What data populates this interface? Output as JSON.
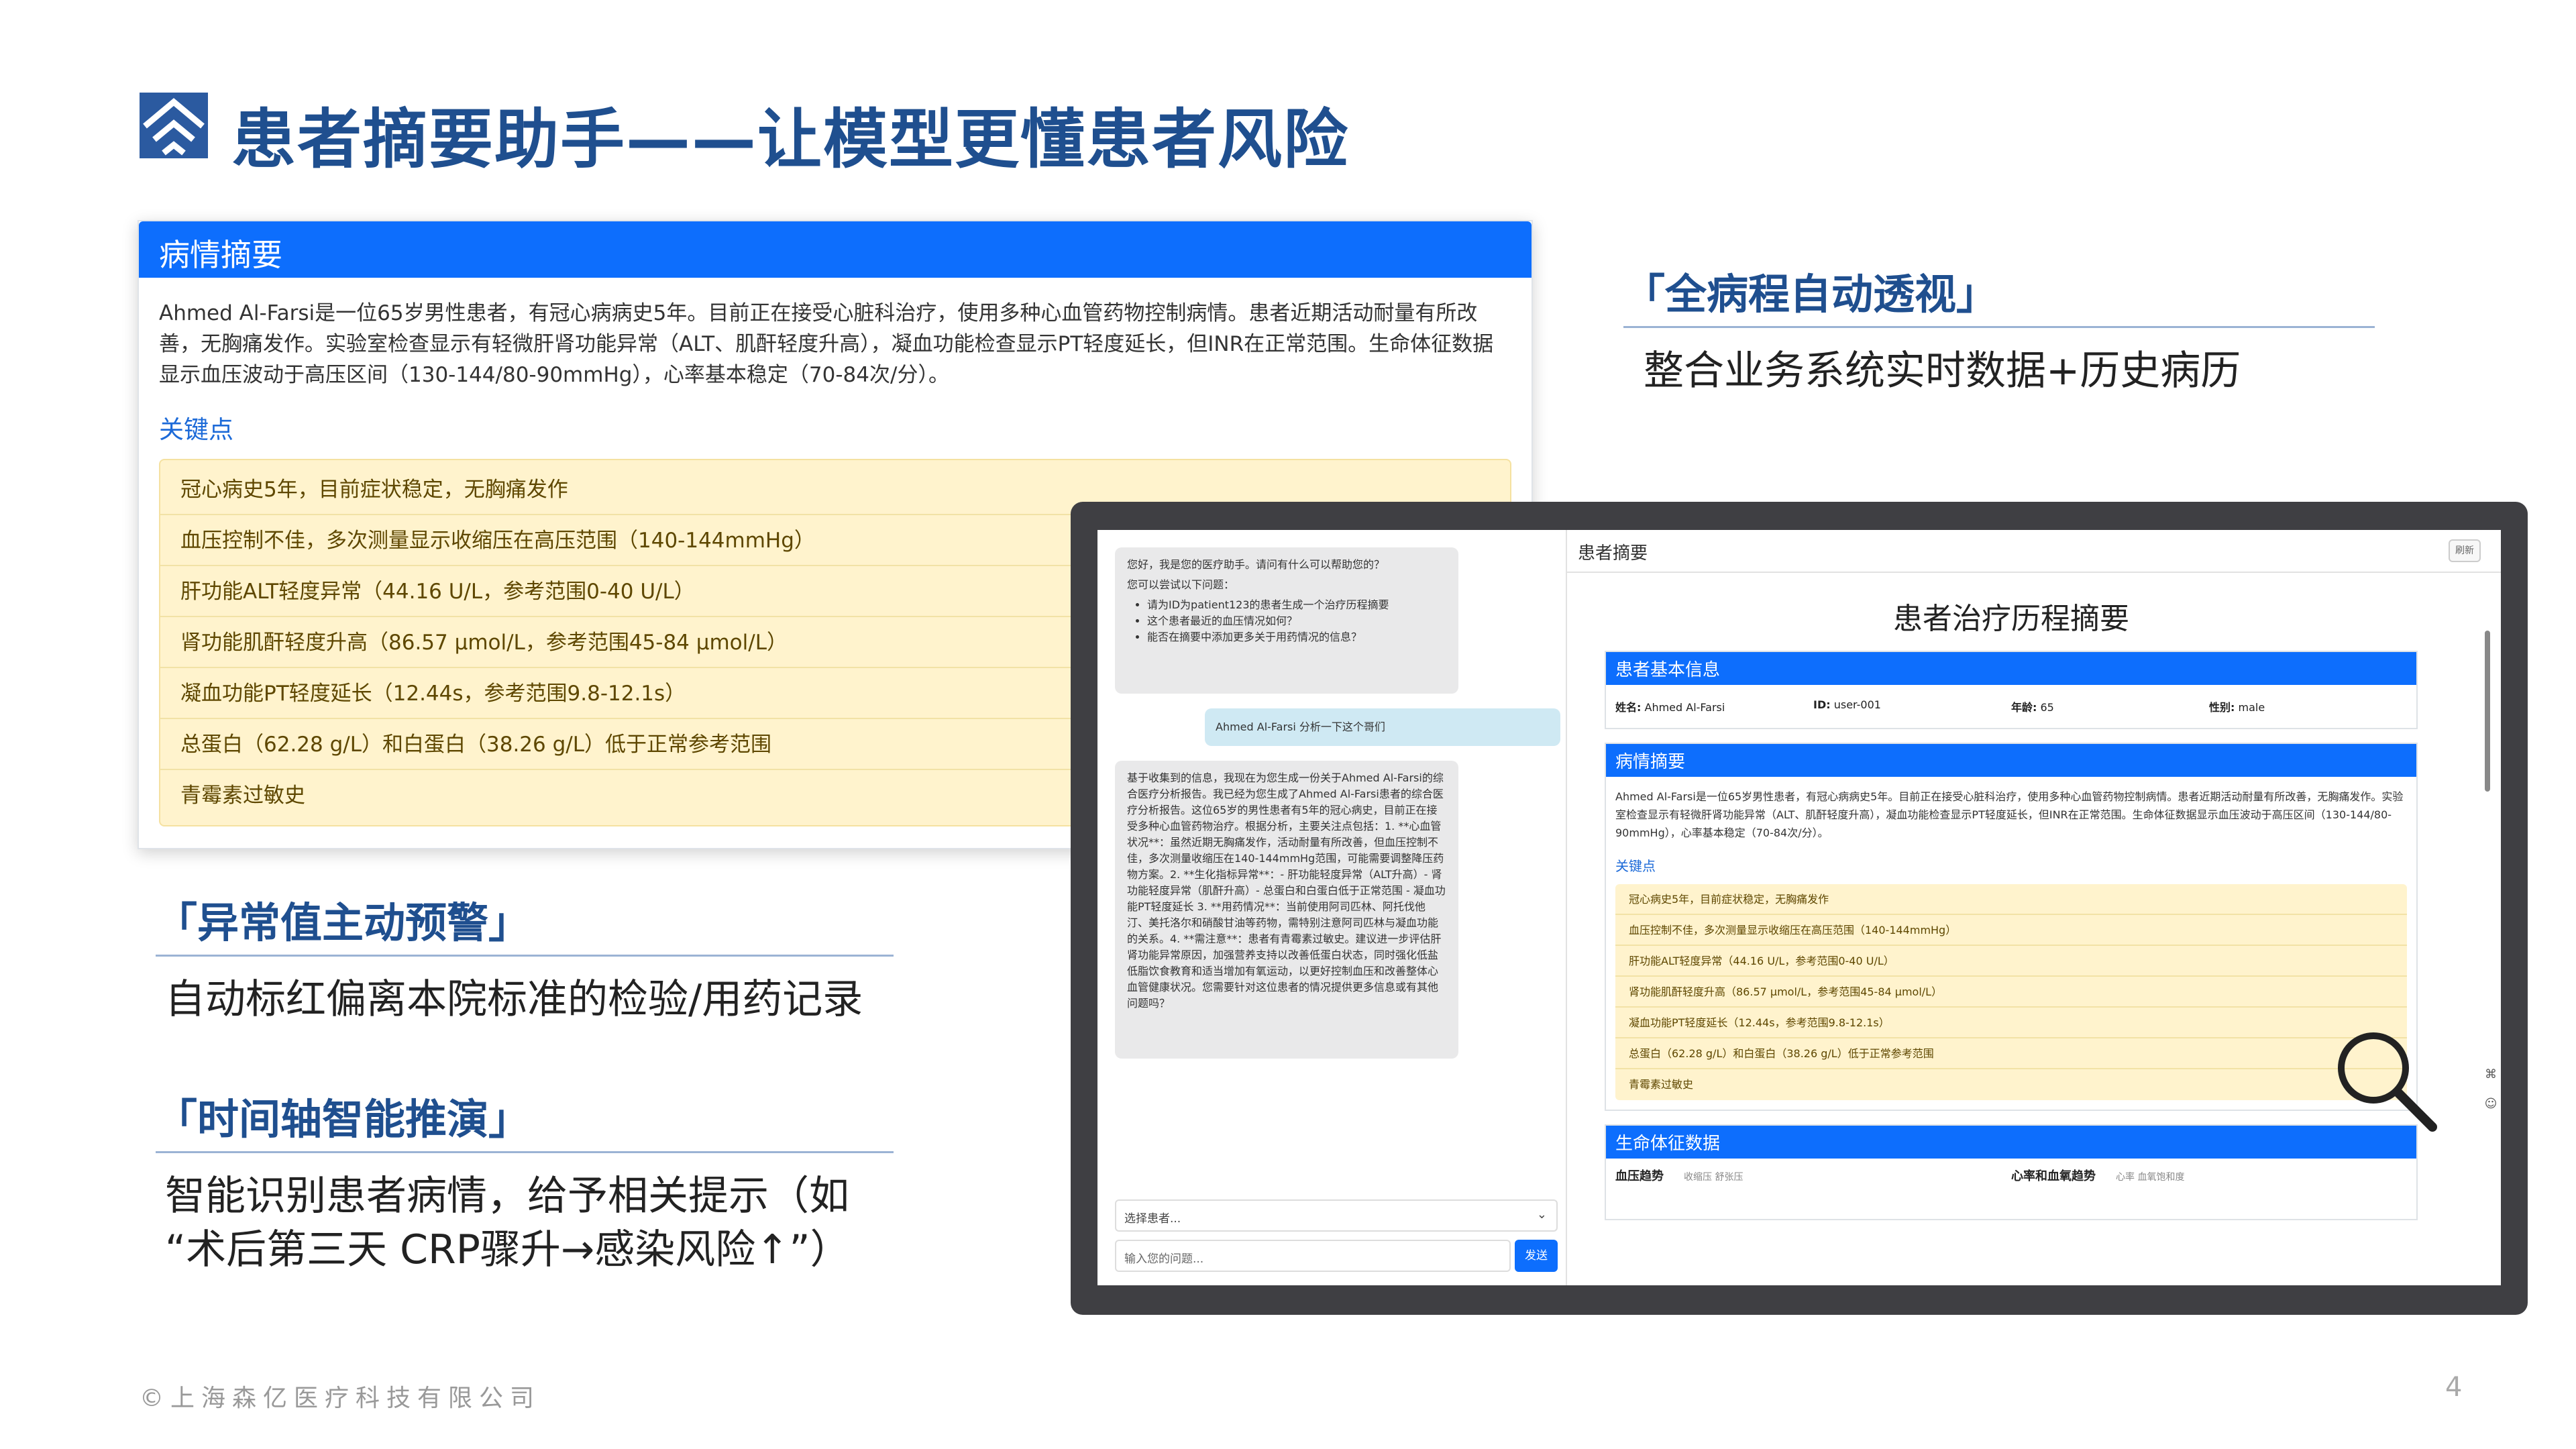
{
  "header": {
    "title": "患者摘要助手——让模型更懂患者风险"
  },
  "left_card": {
    "heading": "病情摘要",
    "summary": "Ahmed Al-Farsi是一位65岁男性患者，有冠心病病史5年。目前正在接受心脏科治疗，使用多种心血管药物控制病情。患者近期活动耐量有所改善，无胸痛发作。实验室检查显示有轻微肝肾功能异常（ALT、肌酐轻度升高），凝血功能检查显示PT轻度延长，但INR在正常范围。生命体征数据显示血压波动于高压区间（130-144/80-90mmHg），心率基本稳定（70-84次/分）。",
    "key_points_title": "关键点",
    "key_points": [
      "冠心病史5年，目前症状稳定，无胸痛发作",
      "血压控制不佳，多次测量显示收缩压在高压范围（140-144mmHg）",
      "肝功能ALT轻度异常（44.16 U/L，参考范围0-40 U/L）",
      "肾功能肌酐轻度升高（86.57 μmol/L，参考范围45-84 μmol/L）",
      "凝血功能PT轻度延长（12.44s，参考范围9.8-12.1s）",
      "总蛋白（62.28 g/L）和白蛋白（38.26 g/L）低于正常参考范围",
      "青霉素过敏史"
    ]
  },
  "sections": [
    {
      "heading": "「全病程自动透视」",
      "text": "整合业务系统实时数据+历史病历"
    },
    {
      "heading": "「异常值主动预警」",
      "text": "自动标红偏离本院标准的检验/用药记录"
    },
    {
      "heading": "「时间轴智能推演」",
      "text": "智能识别患者病情，给予相关提示（如",
      "text2": "“术后第三天 CRP骤升→感染风险↑”）"
    }
  ],
  "app": {
    "chat": {
      "greeting": "您好，我是您的医疗助手。请问有什么可以帮助您的？",
      "try_label": "您可以尝试以下问题：",
      "suggestions": [
        "请为ID为patient123的患者生成一个治疗历程摘要",
        "这个患者最近的血压情况如何？",
        "能否在摘要中添加更多关于用药情况的信息？"
      ],
      "user_message": "Ahmed Al-Farsi 分析一下这个哥们",
      "reply": "基于收集到的信息，我现在为您生成一份关于Ahmed Al-Farsi的综合医疗分析报告。我已经为您生成了Ahmed Al-Farsi患者的综合医疗分析报告。这位65岁的男性患者有5年的冠心病史，目前正在接受多种心血管药物治疗。根据分析，主要关注点包括：1. **心血管状况**：虽然近期无胸痛发作，活动耐量有所改善，但血压控制不佳，多次测量收缩压在140-144mmHg范围，可能需要调整降压药物方案。2. **生化指标异常**：- 肝功能轻度异常（ALT升高）- 肾功能轻度异常（肌酐升高）- 总蛋白和白蛋白低于正常范围 - 凝血功能PT轻度延长 3. **用药情况**：当前使用阿司匹林、阿托伐他汀、美托洛尔和硝酸甘油等药物，需特别注意阿司匹林与凝血功能的关系。4. **需注意**：患者有青霉素过敏史。建议进一步评估肝肾功能异常原因，加强营养支持以改善低蛋白状态，同时强化低盐低脂饮食教育和适当增加有氧运动，以更好控制血压和改善整体心血管健康状况。您需要针对这位患者的情况提供更多信息或有其他问题吗？",
      "select_placeholder": "选择患者...",
      "input_placeholder": "输入您的问题...",
      "send_label": "发送"
    },
    "panel": {
      "tab_title": "患者摘要",
      "refresh_label": "刷新",
      "doc_title": "患者治疗历程摘要",
      "basic_info_heading": "患者基本信息",
      "name_label": "姓名:",
      "name_value": "Ahmed Al-Farsi",
      "id_label": "ID:",
      "id_value": "user-001",
      "age_label": "年龄:",
      "age_value": "65",
      "gender_label": "性别:",
      "gender_value": "male",
      "summary_heading": "病情摘要",
      "key_points_title": "关键点",
      "key_points": [
        "冠心病史5年，目前症状稳定，无胸痛发作",
        "血压控制不佳，多次测量显示收缩压在高压范围（140-144mmHg）",
        "肝功能ALT轻度异常（44.16 U/L，参考范围0-40 U/L）",
        "肾功能肌酐轻度升高（86.57 μmol/L，参考范围45-84 μmol/L）",
        "凝血功能PT轻度延长（12.44s，参考范围9.8-12.1s）",
        "总蛋白（62.28 g/L）和白蛋白（38.26 g/L）低于正常参考范围",
        "青霉素过敏史"
      ],
      "vitals_heading": "生命体征数据",
      "bp_title": "血压趋势",
      "bp_legend": "收缩压  舒张压",
      "hr_title": "心率和血氧趋势",
      "hr_legend": "心率  血氧饱和度"
    }
  },
  "footer": {
    "company": "©上海森亿医疗科技有限公司",
    "page": "4"
  },
  "colors": {
    "accent": "#1f4f8f",
    "primary": "#0d6efd",
    "warning_bg": "#fff3cd"
  }
}
